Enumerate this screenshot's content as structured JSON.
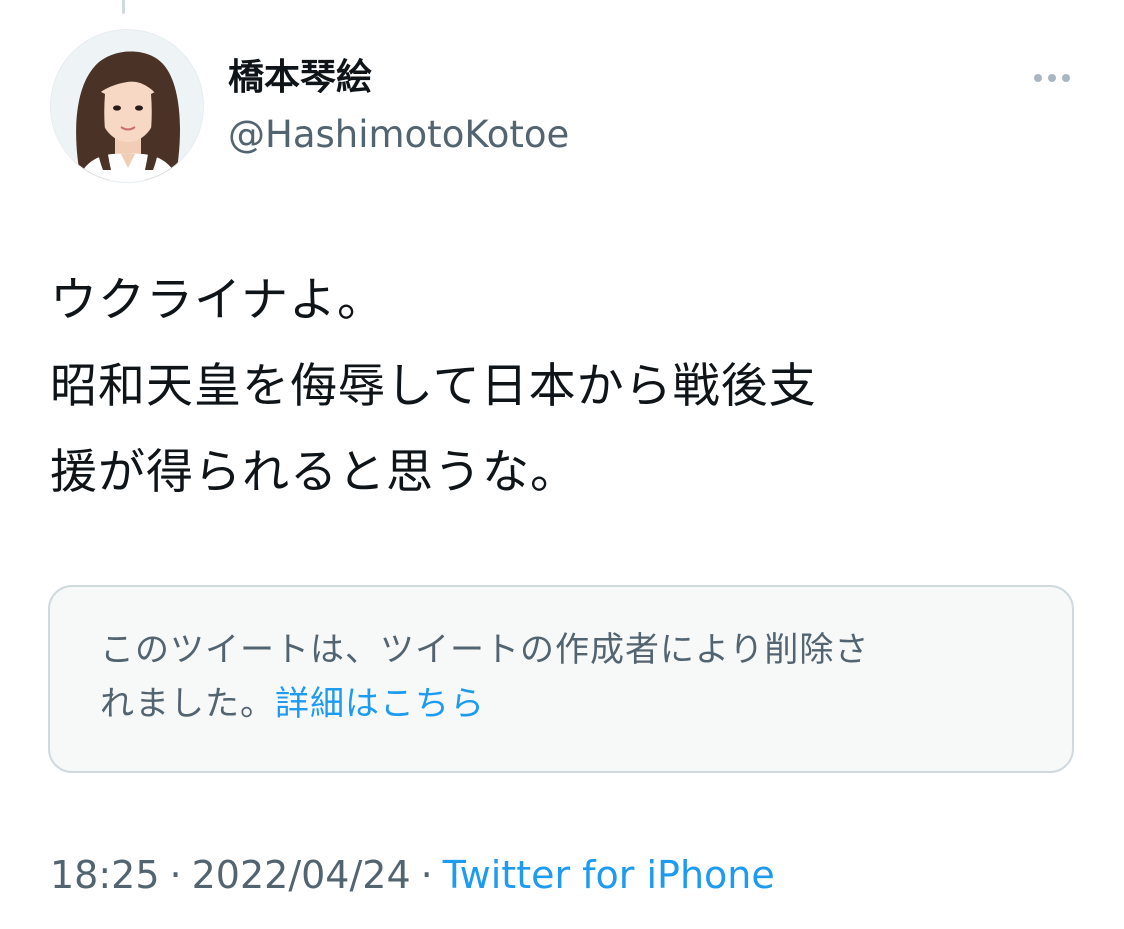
{
  "tweet": {
    "author": {
      "display_name": "橋本琴絵",
      "handle": "@HashimotoKotoe"
    },
    "text_lines": [
      "ウクライナよ。",
      "昭和天皇を侮辱して日本から戦後支",
      "援が得られると思うな。"
    ],
    "quoted_notice": {
      "line1": "このツイートは、ツイートの作成者により削除さ",
      "line2_prefix": "れました。",
      "link_label": "詳細はこちら"
    },
    "meta": {
      "time": "18:25",
      "separator": "·",
      "date": "2022/04/24",
      "source": "Twitter for iPhone"
    },
    "more_icon": "more-horizontal-icon"
  },
  "colors": {
    "text_primary": "#0f1419",
    "text_secondary": "#536471",
    "link": "#1d9bf0",
    "card_border": "#cfd9de",
    "card_background": "#f7f9f9"
  }
}
